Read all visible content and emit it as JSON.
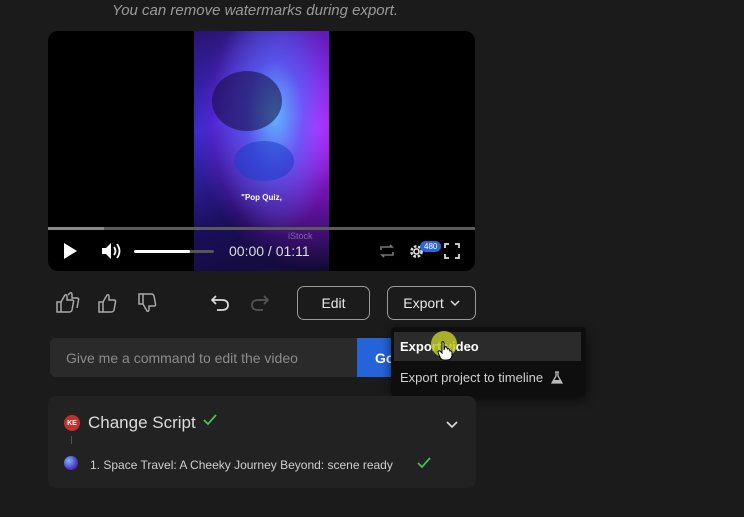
{
  "notice": "You can remove watermarks during export.",
  "player": {
    "caption": "\"Pop Quiz,",
    "watermark": "iStock",
    "time": "00:00 / 01:11",
    "quality": "480",
    "progress": 0.13,
    "volume": 0.7
  },
  "actions": {
    "edit_label": "Edit",
    "export_label": "Export"
  },
  "command": {
    "placeholder": "Give me a command to edit the video",
    "go_label": "Go"
  },
  "export_menu": {
    "items": [
      {
        "label": "Export video"
      },
      {
        "label": "Export project to timeline"
      }
    ]
  },
  "script_panel": {
    "badge": "KE",
    "title": "Change Script",
    "scenes": [
      {
        "label": "1. Space Travel: A Cheeky Journey Beyond: scene ready"
      }
    ]
  },
  "colors": {
    "accent": "#2563d8",
    "success": "#4cbf5a",
    "cursor": "#bec828"
  }
}
